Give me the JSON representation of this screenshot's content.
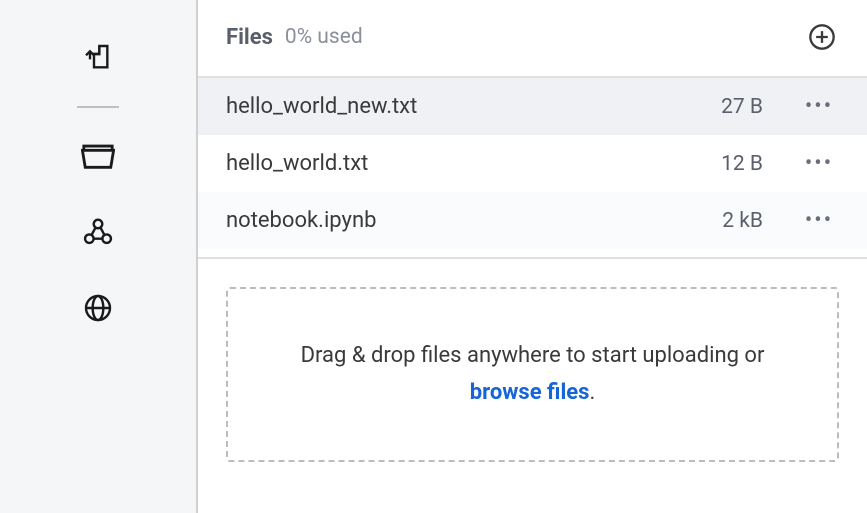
{
  "sidebar": {
    "icons": [
      {
        "name": "upload-file-icon"
      },
      {
        "name": "files-icon"
      },
      {
        "name": "share-icon"
      },
      {
        "name": "globe-icon"
      }
    ]
  },
  "header": {
    "title": "Files",
    "usage": "0% used"
  },
  "files": [
    {
      "name": "hello_world_new.txt",
      "size": "27 B",
      "highlighted": true
    },
    {
      "name": "hello_world.txt",
      "size": "12 B",
      "highlighted": false
    },
    {
      "name": "notebook.ipynb",
      "size": "2 kB",
      "highlighted": false
    }
  ],
  "dropzone": {
    "text_prefix": "Drag & drop files anywhere to start uploading or ",
    "browse_text": "browse files",
    "text_suffix": "."
  }
}
